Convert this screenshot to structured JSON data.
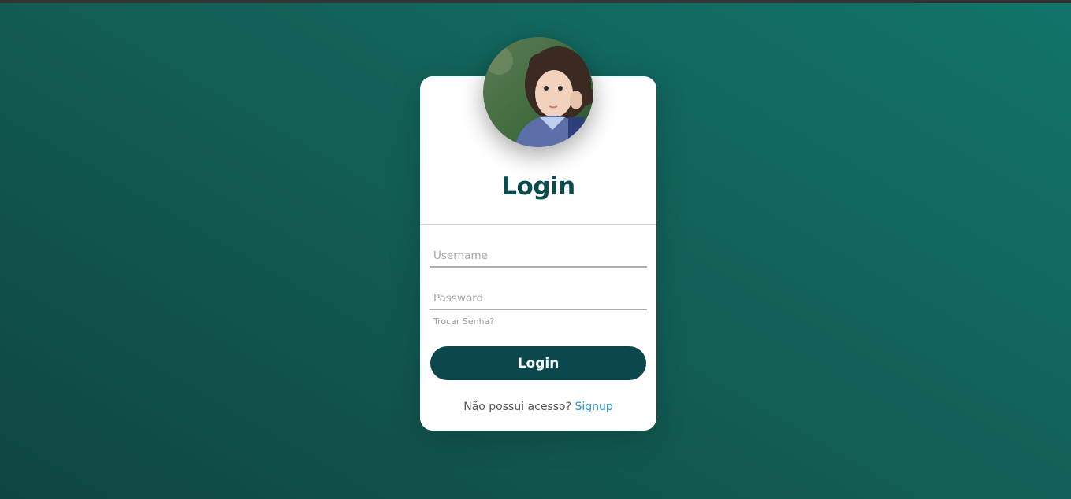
{
  "login_card": {
    "title": "Login",
    "username_placeholder": "Username",
    "password_placeholder": "Password",
    "forgot_password": "Trocar Senha?",
    "login_button": "Login",
    "signup_prompt": "Não possui acesso?",
    "signup_link": "Signup"
  },
  "colors": {
    "background_start": "#0f4641",
    "background_end": "#11746a",
    "title": "#0b4a4e",
    "button": "#0b474d",
    "link": "#2b91c9"
  }
}
